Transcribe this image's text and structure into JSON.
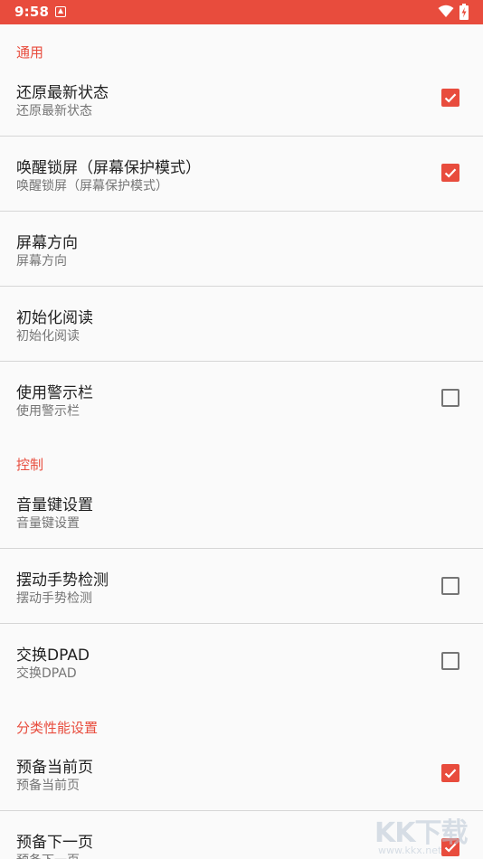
{
  "status_bar": {
    "time": "9:58",
    "notification_icon": "notification-a-icon",
    "wifi_icon": "wifi-icon",
    "battery_icon": "battery-charging-icon"
  },
  "colors": {
    "accent": "#e84c3d",
    "title_text": "#212121",
    "summary_text": "#757575"
  },
  "sections": [
    {
      "header": "通用",
      "items": [
        {
          "title": "还原最新状态",
          "summary": "还原最新状态",
          "checkbox": true
        },
        {
          "title": "唤醒锁屏（屏幕保护模式）",
          "summary": "唤醒锁屏（屏幕保护模式）",
          "checkbox": true
        },
        {
          "title": "屏幕方向",
          "summary": "屏幕方向",
          "checkbox": null
        },
        {
          "title": "初始化阅读",
          "summary": "初始化阅读",
          "checkbox": null
        },
        {
          "title": "使用警示栏",
          "summary": "使用警示栏",
          "checkbox": false
        }
      ]
    },
    {
      "header": "控制",
      "items": [
        {
          "title": "音量键设置",
          "summary": "音量键设置",
          "checkbox": null
        },
        {
          "title": "摆动手势检测",
          "summary": "摆动手势检测",
          "checkbox": false
        },
        {
          "title": "交换DPAD",
          "summary": "交换DPAD",
          "checkbox": false
        }
      ]
    },
    {
      "header": "分类性能设置",
      "items": [
        {
          "title": "预备当前页",
          "summary": "预备当前页",
          "checkbox": true
        },
        {
          "title": "预备下一页",
          "summary": "预备下一页",
          "checkbox": true
        }
      ]
    }
  ],
  "watermark": {
    "logo_text": "KK下载",
    "url_text": "www.kkx.net"
  }
}
